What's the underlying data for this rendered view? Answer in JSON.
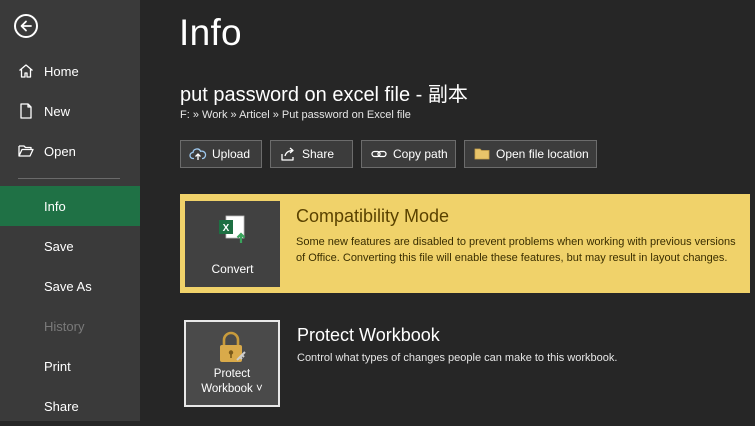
{
  "sidebar": {
    "back_icon": "back-arrow-icon",
    "items": [
      {
        "label": "Home",
        "icon": "home-icon"
      },
      {
        "label": "New",
        "icon": "new-document-icon"
      },
      {
        "label": "Open",
        "icon": "folder-open-icon"
      },
      {
        "label": "Info",
        "active": true
      },
      {
        "label": "Save"
      },
      {
        "label": "Save As"
      },
      {
        "label": "History",
        "disabled": true
      },
      {
        "label": "Print"
      },
      {
        "label": "Share"
      }
    ]
  },
  "main": {
    "title": "Info",
    "file_name": "put password on excel file - 副本",
    "file_path": "F: » Work » Articel » Put password on Excel file",
    "toolbar": {
      "upload": "Upload",
      "share": "Share",
      "copy_path": "Copy path",
      "open_location": "Open file location"
    },
    "compatibility": {
      "title": "Compatibility Mode",
      "description": "Some new features are disabled to prevent problems when working with previous versions of Office. Converting this file will enable these features, but may result in layout changes.",
      "convert_label": "Convert"
    },
    "protect": {
      "title": "Protect Workbook",
      "description": "Control what types of changes people can make to this workbook.",
      "button_line1": "Protect",
      "button_line2": "Workbook ˅"
    }
  },
  "colors": {
    "sidebar_bg": "#3a3a3a",
    "active_green": "#1f7145",
    "compat_yellow": "#f0d26a",
    "main_bg": "#262626"
  }
}
